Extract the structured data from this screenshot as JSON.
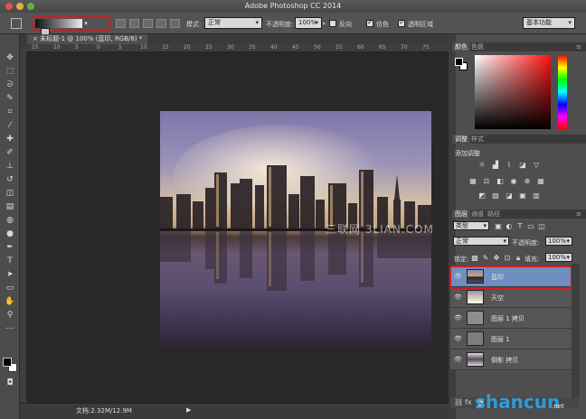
{
  "window": {
    "title": "Adobe Photoshop CC 2014"
  },
  "options_bar": {
    "mode_label": "模式:",
    "mode_value": "正常",
    "opacity_label": "不透明度:",
    "opacity_value": "100%",
    "reverse_label": "反向",
    "dither_label": "仿色",
    "transparency_label": "透明区域",
    "workspace": "基本功能",
    "reverse_checked": false,
    "dither_checked": true,
    "transparency_checked": true
  },
  "document": {
    "tab_label": "未标题-1 @ 100% (蓝印, RGB/8) *",
    "ruler_ticks": [
      "15",
      "10",
      "5",
      "0",
      "5",
      "10",
      "15",
      "20",
      "25",
      "30",
      "35",
      "40",
      "45",
      "50",
      "55",
      "60",
      "65",
      "70",
      "75"
    ]
  },
  "status": {
    "doc_size": "文档:2.32M/12.9M",
    "arrow": "▶"
  },
  "panels": {
    "color_tabs": [
      "颜色",
      "色板"
    ],
    "adjust_tabs": [
      "调整",
      "样式"
    ],
    "adjust_title": "添加调整",
    "layer_tabs": [
      "图层",
      "通道",
      "路径"
    ]
  },
  "layers": {
    "kind_filter": "类型",
    "blend_mode": "正常",
    "opacity_label": "不透明度:",
    "opacity_value": "100%",
    "lock_label": "锁定:",
    "fill_label": "填充:",
    "fill_value": "100%",
    "items": [
      {
        "name": "蓝印",
        "selected": true
      },
      {
        "name": "天空",
        "selected": false
      },
      {
        "name": "图层 1 拷贝",
        "selected": false
      },
      {
        "name": "图层 1",
        "selected": false
      },
      {
        "name": "倒影 拷贝",
        "selected": false
      }
    ]
  },
  "watermark": {
    "center": "三联网 3LIAN.COM",
    "brand": "shancun",
    "brand_sub": ".net"
  },
  "colors": {
    "highlight": "#d21c1c",
    "selected_layer": "#6e8fbf"
  }
}
